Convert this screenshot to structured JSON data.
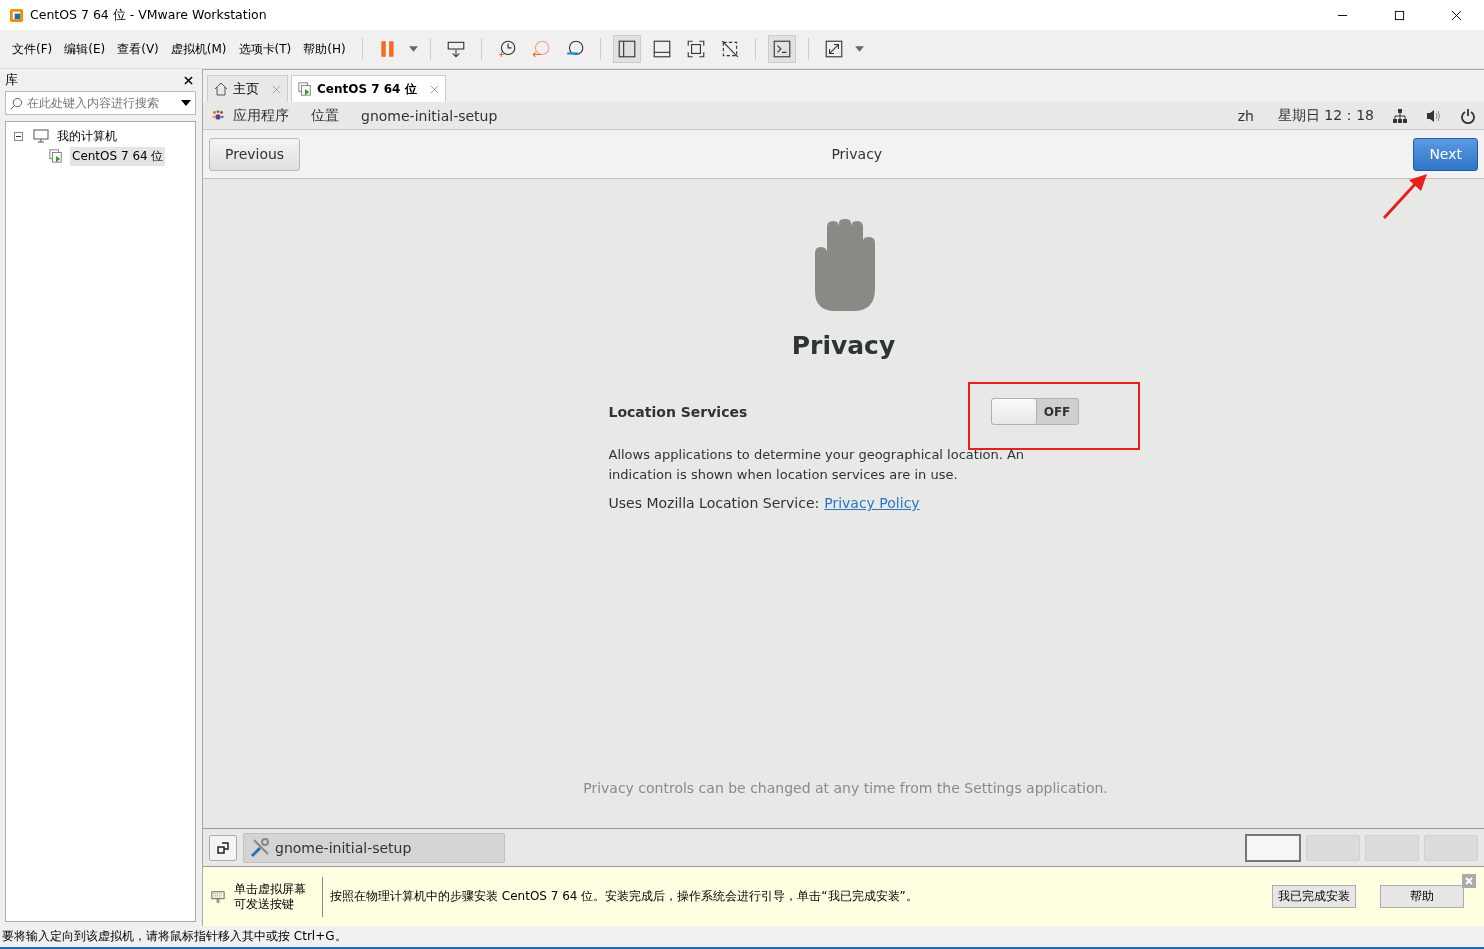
{
  "window": {
    "title": "CentOS 7 64 位 - VMware Workstation"
  },
  "menu": [
    "文件(F)",
    "编辑(E)",
    "查看(V)",
    "虚拟机(M)",
    "选项卡(T)",
    "帮助(H)"
  ],
  "library": {
    "title": "库",
    "search_placeholder": "在此处键入内容进行搜索",
    "tree": [
      {
        "label": "我的计算机",
        "expanded": true,
        "children": [
          {
            "label": "CentOS 7 64 位",
            "selected": true
          }
        ]
      }
    ]
  },
  "tabs": [
    {
      "label": "主页",
      "kind": "home",
      "selected": false
    },
    {
      "label": "CentOS 7 64 位",
      "kind": "vm",
      "selected": true
    }
  ],
  "gnome_top_bar": {
    "applications": "应用程序",
    "places": "位置",
    "app_name": "gnome-initial-setup",
    "language": "zh",
    "clock": "星期日 12：18"
  },
  "header": {
    "previous": "Previous",
    "title": "Privacy",
    "next": "Next"
  },
  "privacy": {
    "heading": "Privacy",
    "setting_label": "Location Services",
    "switch": {
      "on": false,
      "label": "OFF"
    },
    "description": "Allows applications to determine your geographical location. An indication is shown when location services are in use.",
    "link_prefix": "Uses Mozilla Location Service:",
    "link": "Privacy Policy",
    "footer": "Privacy controls can be changed at any time from the Settings application."
  },
  "taskbar": {
    "task": "gnome-initial-setup",
    "workspaces": [
      {
        "selected": true
      },
      {
        "selected": false
      },
      {
        "selected": false
      },
      {
        "selected": false
      }
    ]
  },
  "hint": {
    "lines": [
      "单击虚拟屏幕",
      "可发送按键"
    ],
    "message": "按照在物理计算机中的步骤安装 CentOS 7 64 位。安装完成后，操作系统会进行引导，单击“我已完成安装”。",
    "buttons": [
      "我已完成安装",
      "帮助"
    ]
  },
  "status_bar": "要将输入定向到该虚拟机，请将鼠标指针移入其中或按 Ctrl+G。"
}
